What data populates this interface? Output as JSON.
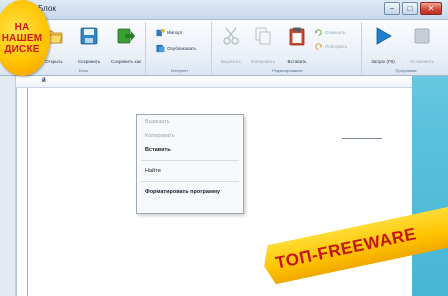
{
  "window": {
    "title": "Блок",
    "buttons": {
      "minimize": "–",
      "maximize": "□",
      "close": "✕"
    }
  },
  "ribbon": {
    "groups": [
      {
        "label": "Блок",
        "buttons": [
          "Открыть",
          "Сохранить",
          "Сохранить как"
        ]
      },
      {
        "label": "Интернет",
        "buttons": [
          "Импорт",
          "Опубликовать"
        ]
      },
      {
        "label": "Редактирование",
        "buttons": [
          "Вырезать",
          "Копировать",
          "Вставить",
          "Отменить",
          "Повторить"
        ]
      },
      {
        "label": "Программа",
        "buttons": [
          "Запуск (F9)",
          "Остановить"
        ]
      }
    ]
  },
  "document": {
    "tab_label": "й"
  },
  "context_menu": {
    "items": [
      "Вырезать",
      "Копировать",
      "Вставить",
      "Найти",
      "Форматировать программу"
    ]
  },
  "promo": {
    "sticker_lines": [
      "НА",
      "НАШЕМ",
      "ДИСКЕ"
    ],
    "banner": "ТОП-FREEWARE"
  },
  "icons": {
    "open": "folder-icon",
    "save": "floppy-disk-icon",
    "save_as": "save-as-arrow-icon",
    "import": "import-icon",
    "publish": "publish-icon",
    "cut": "scissors-icon",
    "copy": "copy-icon",
    "paste": "clipboard-icon",
    "undo": "undo-icon",
    "redo": "redo-icon",
    "run": "play-icon",
    "stop": "stop-icon"
  },
  "colors": {
    "accent_blue": "#1f7fd0",
    "save_green": "#3aa035",
    "paste_red": "#d0472d",
    "sticker_red": "#d31818",
    "banner_yellow": "#ffc400"
  }
}
